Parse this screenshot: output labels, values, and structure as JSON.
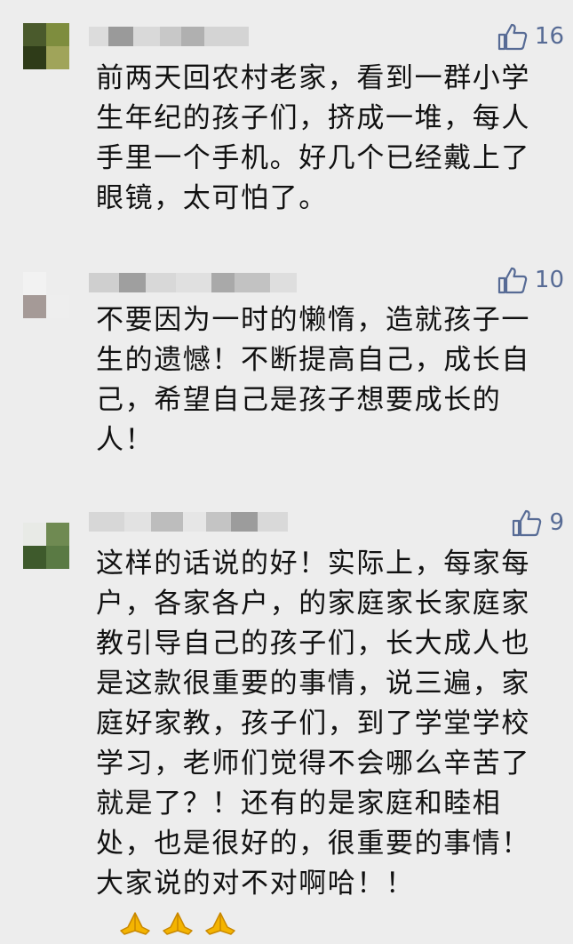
{
  "comments": [
    {
      "likes": "16",
      "text": "前两天回农村老家，看到一群小学生年纪的孩子们，挤成一堆，每人手里一个手机。好几个已经戴上了眼镜，太可怕了。",
      "avatar_colors": [
        "#4a5a2c",
        "#7e8d3e",
        "#2e3b18",
        "#a0a45a"
      ]
    },
    {
      "likes": "10",
      "text": "不要因为一时的懒惰，造就孩子一生的遗憾！不断提高自己，成长自己，希望自己是孩子想要成长的人！",
      "avatar_colors": [
        "#f2f2f2",
        "#ededed",
        "#a59a97",
        "#eeeeee"
      ]
    },
    {
      "likes": "9",
      "text": "这样的话说的好！实际上，每家每户，各家各户，的家庭家长家庭家教引导自己的孩子们，长大成人也是这款很重要的事情，说三遍，家庭好家教，孩子们，到了学堂学校学习，老师们觉得不会哪么辛苦了就是了？！还有的是家庭和睦相处，也是很好的，很重要的事情！大家说的对不对啊哈！！",
      "emoji": "folded-hands-icon",
      "avatar_colors": [
        "#e8eae6",
        "#6f8a52",
        "#3e5a2c",
        "#5a7a44"
      ]
    }
  ],
  "colors": {
    "background": "#ededed",
    "like_color": "#576b95",
    "text_color": "#111111"
  }
}
